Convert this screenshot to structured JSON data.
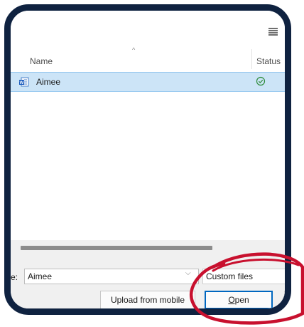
{
  "file_list": {
    "columns": {
      "name": "Name",
      "status": "Status"
    },
    "files": [
      {
        "name": "Aimee",
        "icon": "word-document-icon",
        "status_icon": "synced-check-icon",
        "selected": true
      }
    ]
  },
  "bottom_bar": {
    "file_name_label": "e:",
    "file_name_value": "Aimee",
    "file_type_value": "Custom files",
    "upload_label": "Upload from mobile",
    "open_label": {
      "accel": "O",
      "rest": "pen"
    }
  },
  "colors": {
    "frame": "#0f2240",
    "selection": "#cce4f7",
    "accent": "#0067c0",
    "annotation": "#c8102e",
    "status_ok": "#2e8b3c"
  }
}
